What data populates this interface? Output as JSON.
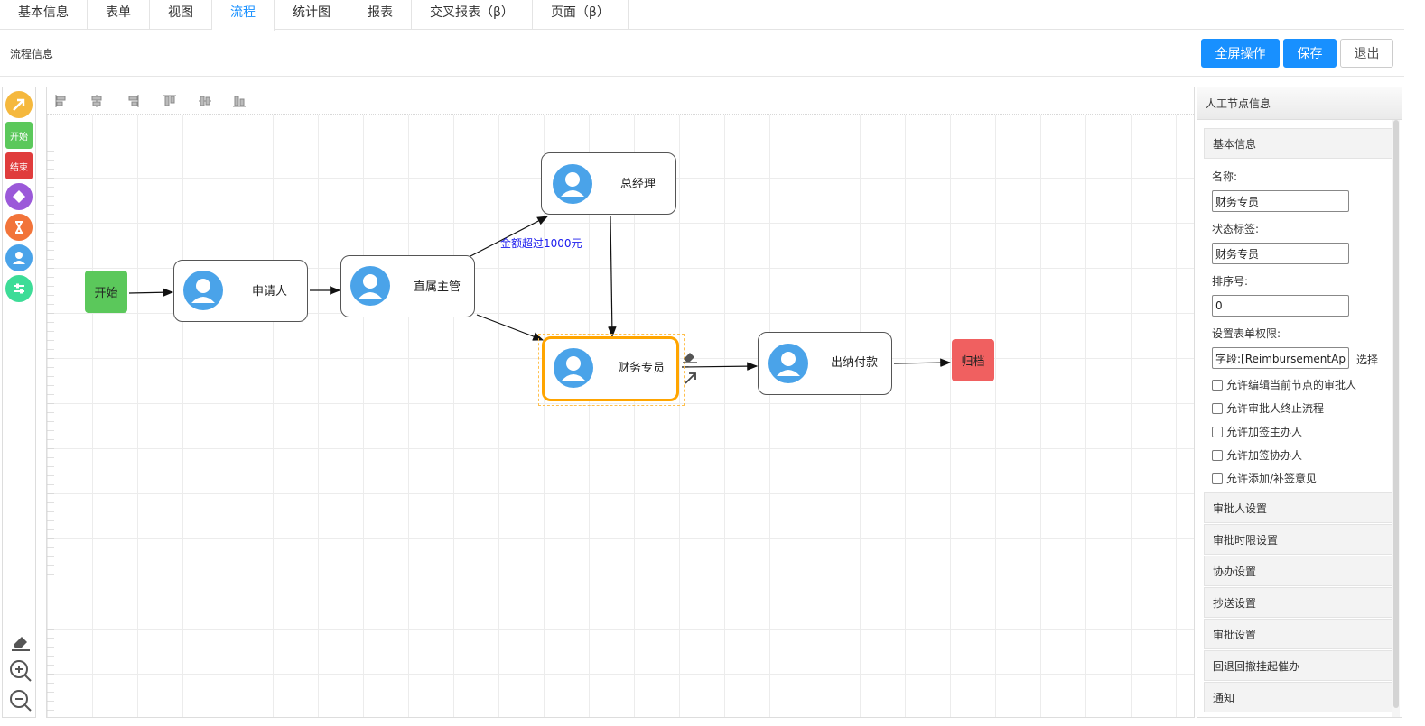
{
  "tabs": [
    {
      "label": "基本信息"
    },
    {
      "label": "表单"
    },
    {
      "label": "视图"
    },
    {
      "label": "流程"
    },
    {
      "label": "统计图"
    },
    {
      "label": "报表"
    },
    {
      "label": "交叉报表（β）"
    },
    {
      "label": "页面（β）"
    }
  ],
  "active_tab": "流程",
  "header": {
    "title": "流程信息",
    "fullscreen_label": "全屏操作",
    "save_label": "保存",
    "exit_label": "退出"
  },
  "palette": {
    "start_label": "开始",
    "end_label": "结束"
  },
  "flow": {
    "nodes": {
      "start": "开始",
      "applicant": "申请人",
      "supervisor": "直属主管",
      "manager": "总经理",
      "finance": "财务专员",
      "cashier": "出纳付款",
      "archive": "归档"
    },
    "edge_label": "金额超过1000元"
  },
  "panel": {
    "title": "人工节点信息",
    "basic_section": "基本信息",
    "name_label": "名称:",
    "name_value": "财务专员",
    "status_label": "状态标签:",
    "status_value": "财务专员",
    "order_label": "排序号:",
    "order_value": "0",
    "perm_label": "设置表单权限:",
    "perm_value": "字段:[ReimbursementApply]",
    "perm_select": "选择",
    "checkboxes": [
      "允许编辑当前节点的审批人",
      "允许审批人终止流程",
      "允许加签主办人",
      "允许加签协办人",
      "允许添加/补签意见"
    ],
    "sections": [
      "审批人设置",
      "审批时限设置",
      "协办设置",
      "抄送设置",
      "审批设置",
      "回退回撤挂起催办",
      "通知"
    ]
  },
  "colors": {
    "primary": "#1890ff",
    "start_green": "#5bc85b",
    "end_red": "#e05050",
    "archive_red": "#f06060",
    "selected_orange": "#ffa500",
    "avatar_blue": "#4aa3e9"
  }
}
